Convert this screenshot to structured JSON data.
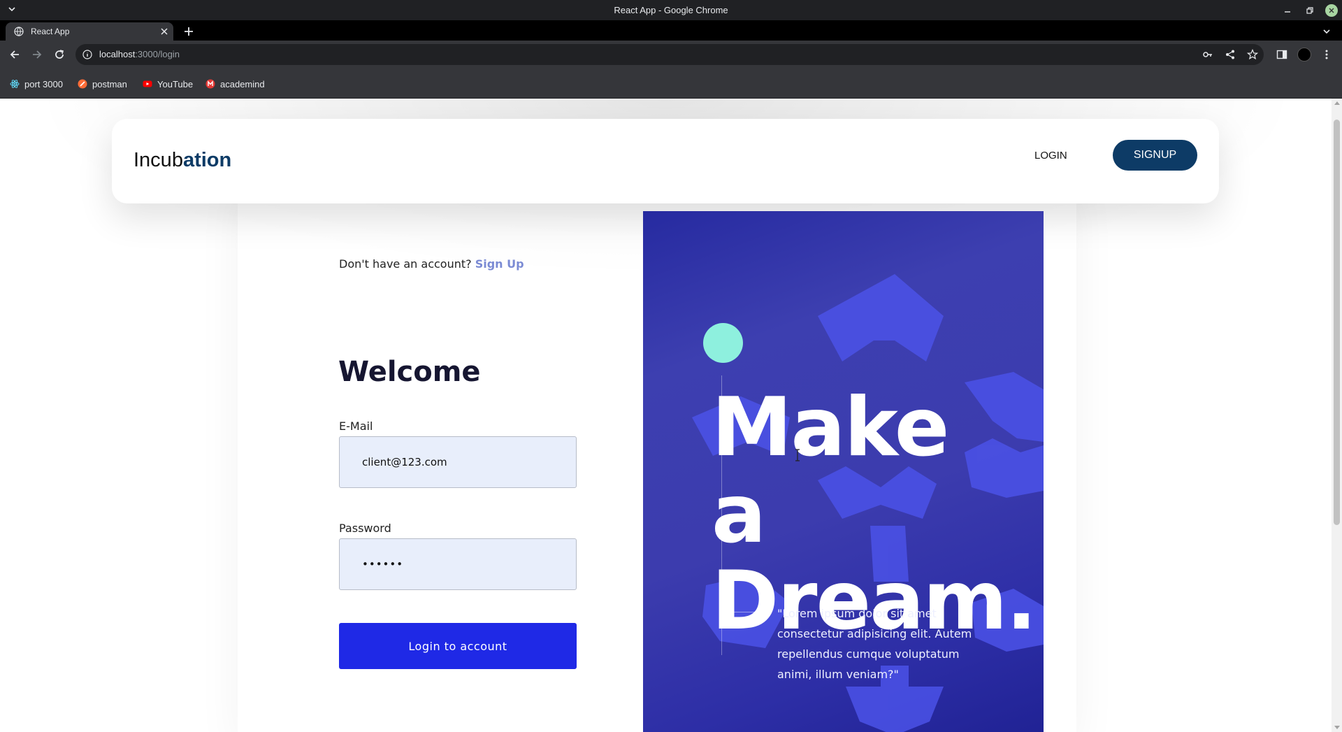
{
  "window": {
    "title": "React App - Google Chrome"
  },
  "tabs": [
    {
      "title": "React App"
    }
  ],
  "toolbar": {
    "url_host": "localhost",
    "url_path": ":3000/login"
  },
  "bookmarks": [
    {
      "label": "port 3000",
      "icon": "react-icon",
      "color": "#61dafb"
    },
    {
      "label": "postman",
      "icon": "postman-icon",
      "color": "#ff6c37"
    },
    {
      "label": "YouTube",
      "icon": "youtube-icon",
      "color": "#ff0000"
    },
    {
      "label": "academind",
      "icon": "academind-icon",
      "color": "#e53935"
    }
  ],
  "navbar": {
    "brand_plain": "Incub",
    "brand_bold": "ation",
    "login_label": "LOGIN",
    "signup_label": "SIGNUP"
  },
  "form": {
    "account_prompt": "Don't have an account?",
    "signup_link": "Sign Up",
    "heading": "Welcome",
    "email_label": "E-Mail",
    "email_value": "client@123.com",
    "password_label": "Password",
    "password_value": "••••••",
    "submit_label": "Login to account"
  },
  "hero": {
    "title": "Make a Dream.",
    "quote": "\"Lorem ipsum dolor sit amet consectetur adipisicing elit. Autem repellendus cumque voluptatum animi, illum veniam?\""
  },
  "colors": {
    "brand": "#0d3b66",
    "button": "#1f29e6",
    "hero_accent": "#8ef0de",
    "hero_bg": "#3c3cae"
  }
}
